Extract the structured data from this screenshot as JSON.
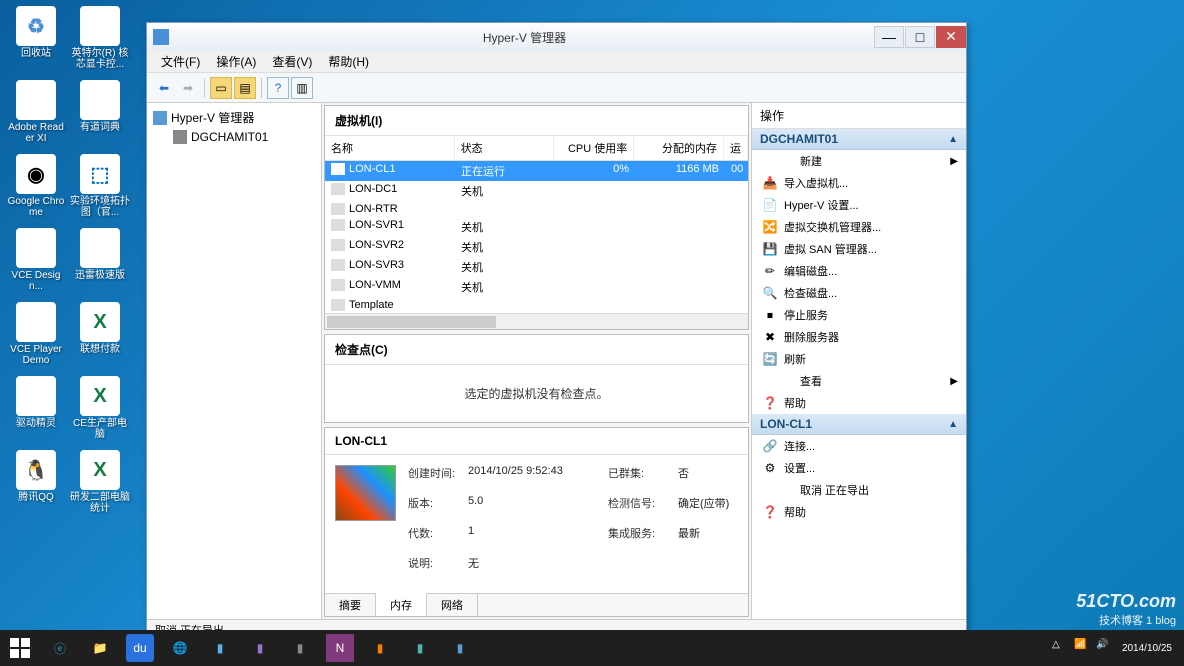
{
  "desktop_icons": [
    {
      "label": "回收站",
      "cls": "bg-recycle",
      "glyph": "♻"
    },
    {
      "label": "英特尔(R) 核芯显卡控...",
      "cls": "bg-intel",
      "glyph": "⚙"
    },
    {
      "label": "Adobe Reader XI",
      "cls": "bg-adobe",
      "glyph": "A"
    },
    {
      "label": "有道词典",
      "cls": "bg-youdao",
      "glyph": "词"
    },
    {
      "label": "Google Chrome",
      "cls": "bg-chrome",
      "glyph": "◉"
    },
    {
      "label": "实验环境拓扑图（官...",
      "cls": "bg-topo",
      "glyph": "⬚"
    },
    {
      "label": "VCE Design...",
      "cls": "bg-vce",
      "glyph": "D"
    },
    {
      "label": "迅雷极速版",
      "cls": "bg-xl",
      "glyph": "↓"
    },
    {
      "label": "VCE Player Demo",
      "cls": "bg-vcep",
      "glyph": "P"
    },
    {
      "label": "联想付款",
      "cls": "bg-excel",
      "glyph": "X"
    },
    {
      "label": "驱动精灵",
      "cls": "bg-drv",
      "glyph": "驱"
    },
    {
      "label": "CE生产部电脑",
      "cls": "bg-excel",
      "glyph": "X"
    },
    {
      "label": "腾讯QQ",
      "cls": "bg-qq",
      "glyph": "🐧"
    },
    {
      "label": "研发二部电脑统计",
      "cls": "bg-excel",
      "glyph": "X"
    }
  ],
  "window": {
    "title": "Hyper-V 管理器",
    "menu": [
      "文件(F)",
      "操作(A)",
      "查看(V)",
      "帮助(H)"
    ],
    "tree": {
      "root": "Hyper-V 管理器",
      "child": "DGCHAMIT01"
    },
    "vm_section": "虚拟机(I)",
    "vm_cols": {
      "name": "名称",
      "state": "状态",
      "cpu": "CPU 使用率",
      "mem": "分配的内存",
      "x": "运"
    },
    "vms": [
      {
        "name": "LON-CL1",
        "state": "正在运行",
        "cpu": "0%",
        "mem": "1166 MB",
        "x": "00",
        "sel": true
      },
      {
        "name": "LON-DC1",
        "state": "关机"
      },
      {
        "name": "LON-RTR",
        "state": ""
      },
      {
        "name": "LON-SVR1",
        "state": "关机"
      },
      {
        "name": "LON-SVR2",
        "state": "关机"
      },
      {
        "name": "LON-SVR3",
        "state": "关机"
      },
      {
        "name": "LON-VMM",
        "state": "关机"
      },
      {
        "name": "Template",
        "state": ""
      }
    ],
    "checkpoints": {
      "title": "检查点(C)",
      "msg": "选定的虚拟机没有检查点。"
    },
    "details": {
      "title": "LON-CL1",
      "props": {
        "created_k": "创建时间:",
        "created_v": "2014/10/25 9:52:43",
        "cluster_k": "已群集:",
        "cluster_v": "否",
        "ver_k": "版本:",
        "ver_v": "5.0",
        "heartbeat_k": "检测信号:",
        "heartbeat_v": "确定(应带)",
        "gen_k": "代数:",
        "gen_v": "1",
        "integ_k": "集成服务:",
        "integ_v": "最新",
        "desc_k": "说明:",
        "desc_v": "无"
      },
      "tabs": [
        "摘要",
        "内存",
        "网络"
      ]
    },
    "actions": {
      "title": "操作",
      "g1": "DGCHAMIT01",
      "g1_items": [
        {
          "icon": "",
          "label": "新建",
          "sub": true
        },
        {
          "icon": "📥",
          "label": "导入虚拟机..."
        },
        {
          "icon": "📄",
          "label": "Hyper-V 设置..."
        },
        {
          "icon": "🔀",
          "label": "虚拟交换机管理器..."
        },
        {
          "icon": "💾",
          "label": "虚拟 SAN 管理器..."
        },
        {
          "icon": "✏",
          "label": "编辑磁盘..."
        },
        {
          "icon": "🔍",
          "label": "检查磁盘..."
        },
        {
          "icon": "⏹",
          "label": "停止服务"
        },
        {
          "icon": "✖",
          "label": "删除服务器"
        },
        {
          "icon": "🔄",
          "label": "刷新"
        },
        {
          "icon": "",
          "label": "查看",
          "sub": true
        },
        {
          "icon": "❓",
          "label": "帮助"
        }
      ],
      "g2": "LON-CL1",
      "g2_items": [
        {
          "icon": "🔗",
          "label": "连接..."
        },
        {
          "icon": "⚙",
          "label": "设置..."
        },
        {
          "icon": "",
          "label": "取消 正在导出"
        },
        {
          "icon": "❓",
          "label": "帮助"
        }
      ]
    },
    "status": "取消 正在导出"
  },
  "watermark": {
    "big": "51CTO.com",
    "small": "技术博客 1",
    "blog": "blog"
  },
  "taskbar": {
    "date": "2014/10/25"
  }
}
